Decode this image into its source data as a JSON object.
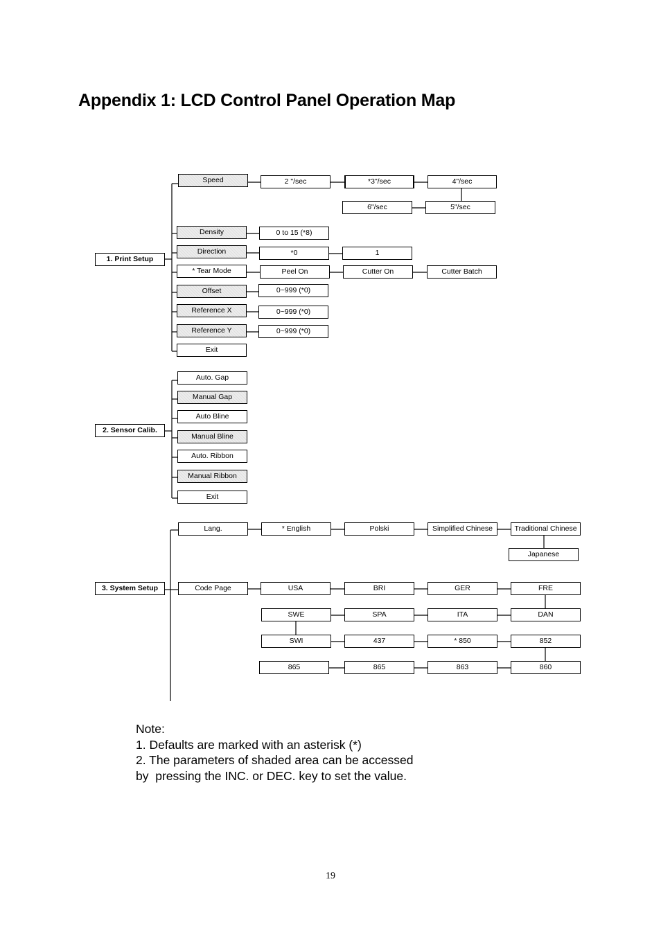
{
  "page": {
    "title": "Appendix 1: LCD Control Panel Operation Map",
    "page_number": "19"
  },
  "print_setup": {
    "root": "1. Print Setup",
    "speed": {
      "label": "Speed",
      "options": [
        "2 \"/sec",
        "*3\"/sec",
        "4\"/sec",
        "5\"/sec",
        "6\"/sec"
      ]
    },
    "density": {
      "label": "Density",
      "options": [
        "0 to 15 (*8)"
      ]
    },
    "direction": {
      "label": "Direction",
      "options": [
        "*0",
        "1"
      ]
    },
    "tear_mode": {
      "label": "* Tear Mode",
      "options": [
        "Peel On",
        "Cutter On",
        "Cutter Batch"
      ]
    },
    "offset": {
      "label": "Offset",
      "options": [
        "0~999 (*0)"
      ]
    },
    "reference_x": {
      "label": "Reference X",
      "options": [
        "0~999 (*0)"
      ]
    },
    "reference_y": {
      "label": "Reference Y",
      "options": [
        "0~999 (*0)"
      ]
    },
    "exit": "Exit"
  },
  "sensor_calib": {
    "root": "2. Sensor Calib.",
    "items": [
      "Auto. Gap",
      "Manual Gap",
      "Auto Bline",
      "Manual Bline",
      "Auto. Ribbon",
      "Manual Ribbon",
      "Exit"
    ]
  },
  "system_setup": {
    "root": "3. System Setup",
    "lang": {
      "label": "Lang.",
      "options": [
        "* English",
        "Polski",
        "Simplified Chinese",
        "Traditional Chinese",
        "Japanese"
      ]
    },
    "code_page": {
      "label": "Code Page",
      "rows": [
        [
          "USA",
          "BRI",
          "GER",
          "FRE"
        ],
        [
          "SWE",
          "SPA",
          "ITA",
          "DAN"
        ],
        [
          "SWI",
          "437",
          "* 850",
          "852"
        ],
        [
          "865",
          "865",
          "863",
          "860"
        ]
      ]
    }
  },
  "notes": {
    "heading": "Note:",
    "line1": "1. Defaults are marked with an asterisk (*)",
    "line2": "2. The parameters of shaded area can be accessed",
    "line3": "by  pressing the INC. or DEC. key to set the value."
  }
}
